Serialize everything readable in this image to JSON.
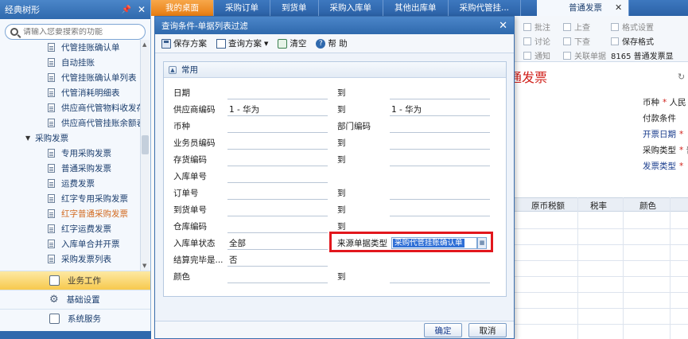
{
  "sidebar": {
    "title": "经典树形",
    "search_placeholder": "请输入您要搜索的功能",
    "tree": [
      {
        "label": "代管挂账确认单",
        "type": "leaf"
      },
      {
        "label": "自动挂账",
        "type": "leaf"
      },
      {
        "label": "代管挂账确认单列表",
        "type": "leaf"
      },
      {
        "label": "代管消耗明细表",
        "type": "leaf"
      },
      {
        "label": "供应商代管物料收发存",
        "type": "leaf"
      },
      {
        "label": "供应商代管挂账余额表",
        "type": "leaf"
      },
      {
        "label": "采购发票",
        "type": "group"
      },
      {
        "label": "专用采购发票",
        "type": "leaf"
      },
      {
        "label": "普通采购发票",
        "type": "leaf"
      },
      {
        "label": "运费发票",
        "type": "leaf"
      },
      {
        "label": "红字专用采购发票",
        "type": "leaf"
      },
      {
        "label": "红字普通采购发票",
        "type": "leaf",
        "highlight": true
      },
      {
        "label": "红字运费发票",
        "type": "leaf"
      },
      {
        "label": "入库单合并开票",
        "type": "leaf"
      },
      {
        "label": "采购发票列表",
        "type": "leaf"
      }
    ],
    "nav": [
      {
        "label": "业务工作",
        "active": true
      },
      {
        "label": "基础设置",
        "active": false
      },
      {
        "label": "系统服务",
        "active": false
      }
    ]
  },
  "tabs": {
    "home": "我的桌面",
    "items": [
      "采购订单",
      "到货单",
      "采购入库单",
      "其他出库单",
      "采购代管挂..."
    ],
    "active": "普通发票"
  },
  "background": {
    "toolbar": {
      "approve": "批注",
      "discuss": "讨论",
      "notify": "通知",
      "prev": "上查",
      "next": "下查",
      "related": "关联单据",
      "format": "格式设置",
      "save_format": "保存格式",
      "template": "8165 普通发票显"
    },
    "title": "通发票",
    "fields": {
      "currency": "币种",
      "currency_value": "人民",
      "payment": "付款条件",
      "invoice_date": "开票日期",
      "purchase_type": "采购类型",
      "purchase_type_value": "普",
      "invoice_type": "发票类型"
    },
    "grid_headers": [
      "原币税额",
      "税率",
      "颜色"
    ]
  },
  "dialog": {
    "title": "查询条件-单据列表过滤",
    "toolbar": {
      "save_scheme": "保存方案",
      "query_scheme": "查询方案",
      "clear": "清空",
      "help": "帮 助"
    },
    "section": "常用",
    "rows": [
      {
        "label": "日期",
        "value": "",
        "label2": "到",
        "value2": ""
      },
      {
        "label": "供应商编码",
        "value": "1 - 华为",
        "label2": "到",
        "value2": "1 - 华为"
      },
      {
        "label": "币种",
        "value": "",
        "label2": "部门编码",
        "value2": ""
      },
      {
        "label": "业务员编码",
        "value": "",
        "label2": "到",
        "value2": ""
      },
      {
        "label": "存货编码",
        "value": "",
        "label2": "到",
        "value2": ""
      },
      {
        "label": "入库单号",
        "value": "",
        "label2": "",
        "value2": ""
      },
      {
        "label": "订单号",
        "value": "",
        "label2": "到",
        "value2": ""
      },
      {
        "label": "到货单号",
        "value": "",
        "label2": "到",
        "value2": ""
      },
      {
        "label": "仓库编码",
        "value": "",
        "label2": "到",
        "value2": ""
      },
      {
        "label": "入库单状态",
        "value": "全部",
        "label2": "来源单据类型",
        "value2": "采购代管挂账确认单"
      },
      {
        "label": "结算完毕是...",
        "value": "否",
        "label2": "",
        "value2": ""
      },
      {
        "label": "颜色",
        "value": "",
        "label2": "到",
        "value2": ""
      }
    ],
    "ok": "确定",
    "cancel": "取消"
  }
}
